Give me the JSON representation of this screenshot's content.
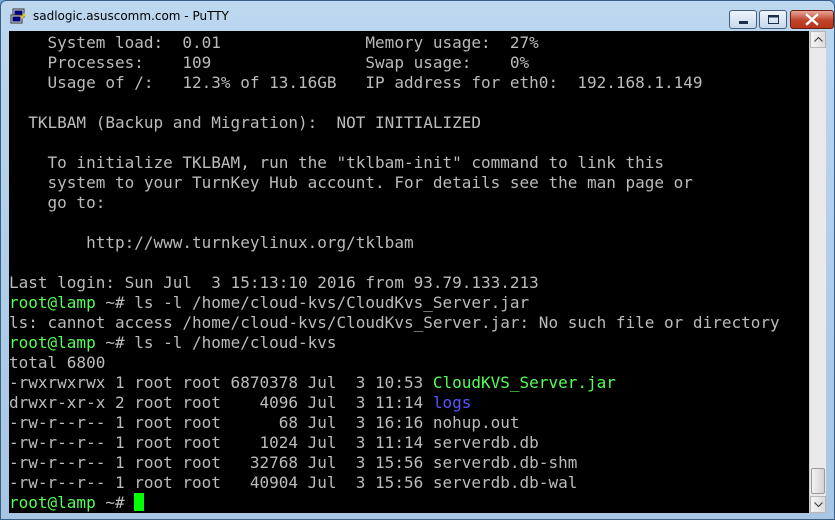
{
  "window": {
    "title": "sadlogic.asuscomm.com - PuTTY",
    "icons": {
      "app": "putty-icon",
      "minimize": "minimize-icon",
      "maximize": "maximize-icon",
      "close": "close-icon"
    }
  },
  "terminal": {
    "colors": {
      "background": "#000000",
      "text": "#bbbbbb",
      "green": "#55ff55",
      "blue": "#5555ff",
      "cursor": "#00ff00"
    },
    "motd": {
      "system_load": "    System load:  0.01               Memory usage:  27%",
      "processes": "    Processes:    109                Swap usage:    0%",
      "usage": "    Usage of /:   12.3% of 13.16GB   IP address for eth0:  192.168.1.149",
      "tklbam_status": "  TKLBAM (Backup and Migration):  NOT INITIALIZED",
      "init_line1": "    To initialize TKLBAM, run the \"tklbam-init\" command to link this",
      "init_line2": "    system to your TurnKey Hub account. For details see the man page or",
      "init_line3": "    go to:",
      "url": "        http://www.turnkeylinux.org/tklbam"
    },
    "last_login": "Last login: Sun Jul  3 15:13:10 2016 from 93.79.133.213",
    "prompt_user": "root@lamp",
    "prompt_path": " ~# ",
    "cmd1": "ls -l /home/cloud-kvs/CloudKvs_Server.jar",
    "error": "ls: cannot access /home/cloud-kvs/CloudKvs_Server.jar: No such file or directory",
    "cmd2": "ls -l /home/cloud-kvs",
    "total": "total 6800",
    "listing": [
      {
        "meta": "-rwxrwxrwx 1 root root 6870378 Jul  3 10:53 ",
        "name": "CloudKVS_Server.jar"
      },
      {
        "meta": "drwxr-xr-x 2 root root    4096 Jul  3 11:14 ",
        "name": "logs"
      },
      {
        "meta": "-rw-r--r-- 1 root root      68 Jul  3 16:16 ",
        "name": "nohup.out"
      },
      {
        "meta": "-rw-r--r-- 1 root root    1024 Jul  3 11:14 ",
        "name": "serverdb.db"
      },
      {
        "meta": "-rw-r--r-- 1 root root   32768 Jul  3 15:56 ",
        "name": "serverdb.db-shm"
      },
      {
        "meta": "-rw-r--r-- 1 root root   40904 Jul  3 15:56 ",
        "name": "serverdb.db-wal"
      }
    ]
  }
}
